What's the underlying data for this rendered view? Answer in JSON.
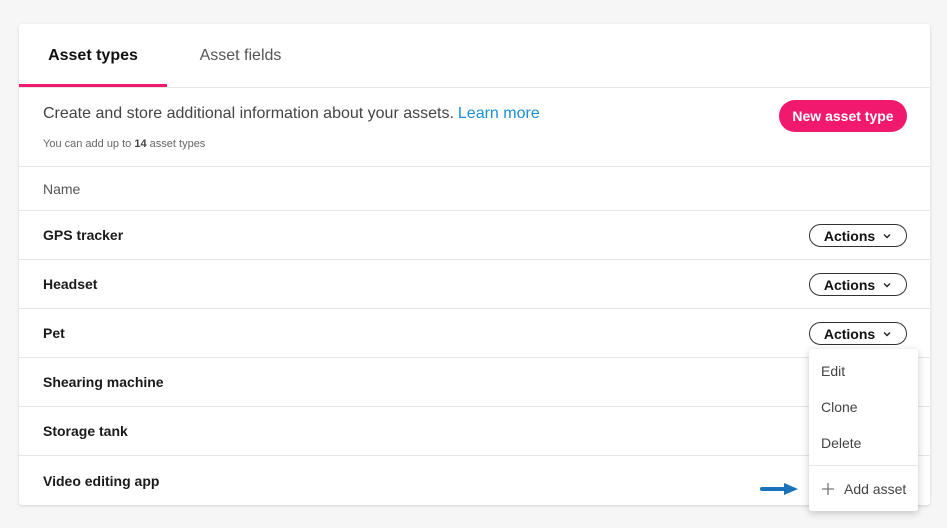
{
  "tabs": [
    {
      "label": "Asset types",
      "active": true
    },
    {
      "label": "Asset fields",
      "active": false
    }
  ],
  "info": {
    "text": "Create and store additional information about your assets.",
    "link": "Learn more",
    "sub_prefix": "You can add up to",
    "sub_count": "14",
    "sub_suffix": "asset types",
    "new_button": "New asset type"
  },
  "table": {
    "header": "Name",
    "action_label": "Actions",
    "rows": [
      {
        "name": "GPS tracker",
        "has_actions": true
      },
      {
        "name": "Headset",
        "has_actions": true
      },
      {
        "name": "Pet",
        "has_actions": true
      },
      {
        "name": "Shearing machine",
        "has_actions": false
      },
      {
        "name": "Storage tank",
        "has_actions": false
      },
      {
        "name": "Video editing app",
        "has_actions": false
      }
    ]
  },
  "dropdown": {
    "items": [
      "Edit",
      "Clone",
      "Delete"
    ],
    "add_label": "Add asset"
  },
  "colors": {
    "accent": "#f0196e",
    "link": "#1a8ed6",
    "arrow": "#1a73b8"
  },
  "icons": {
    "chevron": "chevron-down-icon",
    "plus": "plus-icon",
    "pointer": "arrow-right-icon"
  }
}
